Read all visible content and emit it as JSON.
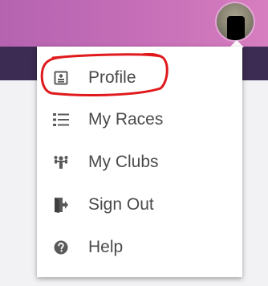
{
  "colors": {
    "header_gradient_start": "#b563b0",
    "header_gradient_end": "#d77ec0",
    "subbar": "#3c2b52",
    "menu_text": "#4a4a4a",
    "icon": "#5a5a5a",
    "annotation": "#e0191c"
  },
  "user": {
    "avatar_icon": "user-avatar"
  },
  "menu": {
    "items": [
      {
        "label": "Profile",
        "icon": "profile-card-icon"
      },
      {
        "label": "My Races",
        "icon": "list-icon"
      },
      {
        "label": "My Clubs",
        "icon": "group-icon"
      },
      {
        "label": "Sign Out",
        "icon": "sign-out-icon"
      },
      {
        "label": "Help",
        "icon": "question-circle-icon"
      }
    ]
  }
}
